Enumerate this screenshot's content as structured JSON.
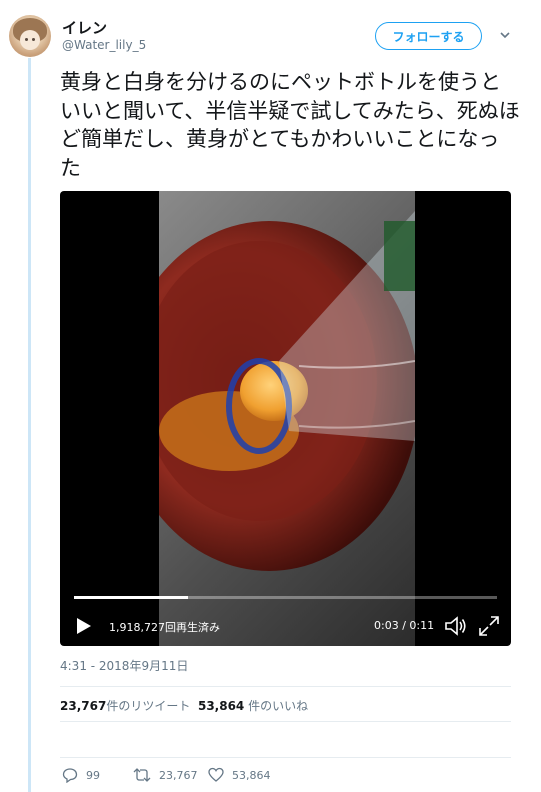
{
  "user": {
    "display_name": "イレン",
    "handle": "@Water_lily_5",
    "follow_label": "フォローする"
  },
  "tweet": {
    "text": "黄身と白身を分けるのにペットボトルを使うといいと聞いて、半信半疑で試してみたら、死ぬほど簡単だし、黄身がとてもかわいいことになった",
    "timestamp": "4:31 - 2018年9月11日"
  },
  "video": {
    "views": "1,918,727回再生済み",
    "time": "0:03 / 0:11",
    "progress": 0.27
  },
  "stats": {
    "retweets_count": "23,767",
    "retweets_label": "件のリツイート",
    "likes_count": "53,864",
    "likes_label": " 件のいいね"
  },
  "actions": {
    "replies": "99",
    "retweets": "23,767",
    "likes": "53,864"
  },
  "colors": {
    "accent": "#1da1f2",
    "muted": "#657786",
    "thread_line": "#cde6f7"
  }
}
